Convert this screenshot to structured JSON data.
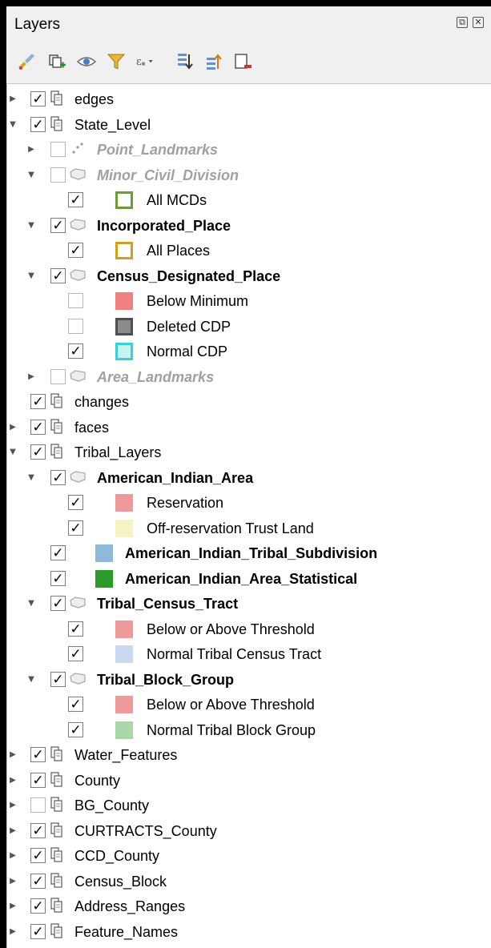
{
  "panel": {
    "title": "Layers",
    "float_button": "⧉",
    "close_button": "✕"
  },
  "toolbar": [
    {
      "name": "style-manager-icon"
    },
    {
      "name": "add-group-icon"
    },
    {
      "name": "visibility-eye-icon"
    },
    {
      "name": "filter-legend-icon"
    },
    {
      "name": "filter-expression-icon"
    },
    {
      "name": "expand-all-icon"
    },
    {
      "name": "collapse-all-icon"
    },
    {
      "name": "remove-layer-icon"
    }
  ],
  "colors": {
    "all_mcds": "#6e9a3c",
    "all_places": "#d1a218",
    "below_minimum": "#f08080",
    "deleted_cdp_fill": "#8b8b8b",
    "deleted_cdp_border": "#505050",
    "normal_cdp_fill": "#c8f2ee",
    "normal_cdp_border": "#3ccfcf",
    "reservation": "#ee9a9a",
    "offres_trust": "#f5f3c4",
    "tribal_subdivision": "#8fb9dc",
    "aia_statistical": "#2e9a2e",
    "below_above": "#ee9a9a",
    "normal_tract": "#c9d9f0",
    "normal_bg": "#a8d8a8"
  },
  "tree": [
    {
      "label": "edges",
      "arrow": "collapsed",
      "checked": true,
      "icon": "group-icon"
    },
    {
      "label": "State_Level",
      "arrow": "expanded",
      "checked": true,
      "icon": "group-icon"
    },
    {
      "label": "Point_Landmarks",
      "arrow": "collapsed",
      "checked": false,
      "icon": "point-layer-icon"
    },
    {
      "label": "Minor_Civil_Division",
      "arrow": "expanded",
      "checked": false,
      "icon": "polygon-layer-icon"
    },
    {
      "label": "All MCDs",
      "arrow": "none",
      "checked": true,
      "icon": "symbol"
    },
    {
      "label": "Incorporated_Place",
      "arrow": "expanded",
      "checked": true,
      "icon": "polygon-layer-icon"
    },
    {
      "label": "All Places",
      "arrow": "none",
      "checked": true,
      "icon": "symbol"
    },
    {
      "label": "Census_Designated_Place",
      "arrow": "expanded",
      "checked": true,
      "icon": "polygon-layer-icon"
    },
    {
      "label": "Below Minimum",
      "arrow": "none",
      "checked": false,
      "icon": "symbol"
    },
    {
      "label": "Deleted CDP",
      "arrow": "none",
      "checked": false,
      "icon": "symbol"
    },
    {
      "label": "Normal CDP",
      "arrow": "none",
      "checked": true,
      "icon": "symbol"
    },
    {
      "label": "Area_Landmarks",
      "arrow": "collapsed",
      "checked": false,
      "icon": "polygon-layer-icon"
    },
    {
      "label": "changes",
      "arrow": "none",
      "checked": true,
      "icon": "group-icon"
    },
    {
      "label": "faces",
      "arrow": "collapsed",
      "checked": true,
      "icon": "group-icon"
    },
    {
      "label": "Tribal_Layers",
      "arrow": "expanded",
      "checked": true,
      "icon": "group-icon"
    },
    {
      "label": "American_Indian_Area",
      "arrow": "expanded",
      "checked": true,
      "icon": "polygon-layer-icon"
    },
    {
      "label": "Reservation",
      "arrow": "none",
      "checked": true,
      "icon": "symbol"
    },
    {
      "label": "Off-reservation Trust Land",
      "arrow": "none",
      "checked": true,
      "icon": "symbol"
    },
    {
      "label": "American_Indian_Tribal_Subdivision",
      "arrow": "none",
      "checked": true,
      "icon": "symbol"
    },
    {
      "label": "American_Indian_Area_Statistical",
      "arrow": "none",
      "checked": true,
      "icon": "symbol"
    },
    {
      "label": "Tribal_Census_Tract",
      "arrow": "expanded",
      "checked": true,
      "icon": "polygon-layer-icon"
    },
    {
      "label": "Below or Above Threshold",
      "arrow": "none",
      "checked": true,
      "icon": "symbol"
    },
    {
      "label": "Normal Tribal Census Tract",
      "arrow": "none",
      "checked": true,
      "icon": "symbol"
    },
    {
      "label": "Tribal_Block_Group",
      "arrow": "expanded",
      "checked": true,
      "icon": "polygon-layer-icon"
    },
    {
      "label": "Below or Above Threshold",
      "arrow": "none",
      "checked": true,
      "icon": "symbol"
    },
    {
      "label": "Normal Tribal Block Group",
      "arrow": "none",
      "checked": true,
      "icon": "symbol"
    },
    {
      "label": "Water_Features",
      "arrow": "collapsed",
      "checked": true,
      "icon": "group-icon"
    },
    {
      "label": "County",
      "arrow": "collapsed",
      "checked": true,
      "icon": "group-icon"
    },
    {
      "label": "BG_County",
      "arrow": "collapsed",
      "checked": false,
      "icon": "group-icon"
    },
    {
      "label": "CURTRACTS_County",
      "arrow": "collapsed",
      "checked": true,
      "icon": "group-icon"
    },
    {
      "label": "CCD_County",
      "arrow": "collapsed",
      "checked": true,
      "icon": "group-icon"
    },
    {
      "label": "Census_Block",
      "arrow": "collapsed",
      "checked": true,
      "icon": "group-icon"
    },
    {
      "label": "Address_Ranges",
      "arrow": "collapsed",
      "checked": true,
      "icon": "group-icon"
    },
    {
      "label": "Feature_Names",
      "arrow": "collapsed",
      "checked": true,
      "icon": "group-icon"
    }
  ]
}
